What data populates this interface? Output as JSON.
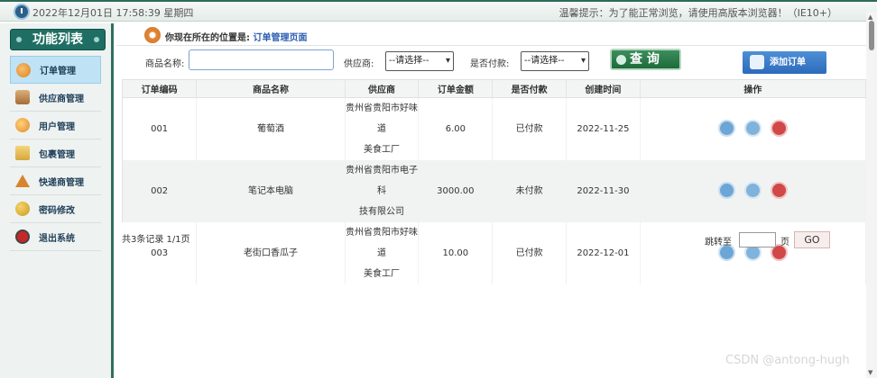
{
  "topbar": {
    "datetime": "2022年12月01日 17:58:39 星期四",
    "tip": "温馨提示：为了能正常浏览，请使用高版本浏览器！（IE10+）"
  },
  "sidebar": {
    "title": "功能列表",
    "items": [
      {
        "label": "订单管理",
        "icon": "order-icon",
        "active": true
      },
      {
        "label": "供应商管理",
        "icon": "supplier-icon",
        "active": false
      },
      {
        "label": "用户管理",
        "icon": "user-icon",
        "active": false
      },
      {
        "label": "包裹管理",
        "icon": "package-icon",
        "active": false
      },
      {
        "label": "快递商管理",
        "icon": "express-icon",
        "active": false
      },
      {
        "label": "密码修改",
        "icon": "key-icon",
        "active": false
      },
      {
        "label": "退出系统",
        "icon": "exit-icon",
        "active": false
      }
    ]
  },
  "location": {
    "prefix": "你现在所在的位置是:",
    "current": "订单管理页面"
  },
  "search": {
    "product_label": "商品名称:",
    "product_value": "",
    "supplier_label": "供应商:",
    "supplier_value": "--请选择--",
    "paid_label": "是否付款:",
    "paid_value": "--请选择--",
    "query_label": "查 询",
    "add_label": "添加订单"
  },
  "table": {
    "columns": [
      "订单编码",
      "商品名称",
      "供应商",
      "订单金额",
      "是否付款",
      "创建时间",
      "操作"
    ],
    "rows": [
      {
        "code": "001",
        "product": "葡萄酒",
        "supplier_1": "贵州省贵阳市好味道",
        "supplier_2": "美食工厂",
        "amount": "6.00",
        "paid": "已付款",
        "created": "2022-11-25"
      },
      {
        "code": "002",
        "product": "笔记本电脑",
        "supplier_1": "贵州省贵阳市电子科",
        "supplier_2": "技有限公司",
        "amount": "3000.00",
        "paid": "未付款",
        "created": "2022-11-30"
      },
      {
        "code": "003",
        "product": "老街口香瓜子",
        "supplier_1": "贵州省贵阳市好味道",
        "supplier_2": "美食工厂",
        "amount": "10.00",
        "paid": "已付款",
        "created": "2022-12-01"
      }
    ]
  },
  "pager": {
    "summary": "共3条记录   1/1页",
    "goto_label": "跳转至",
    "page_unit": "页",
    "go_label": "GO"
  },
  "watermark": "CSDN @antong-hugh"
}
